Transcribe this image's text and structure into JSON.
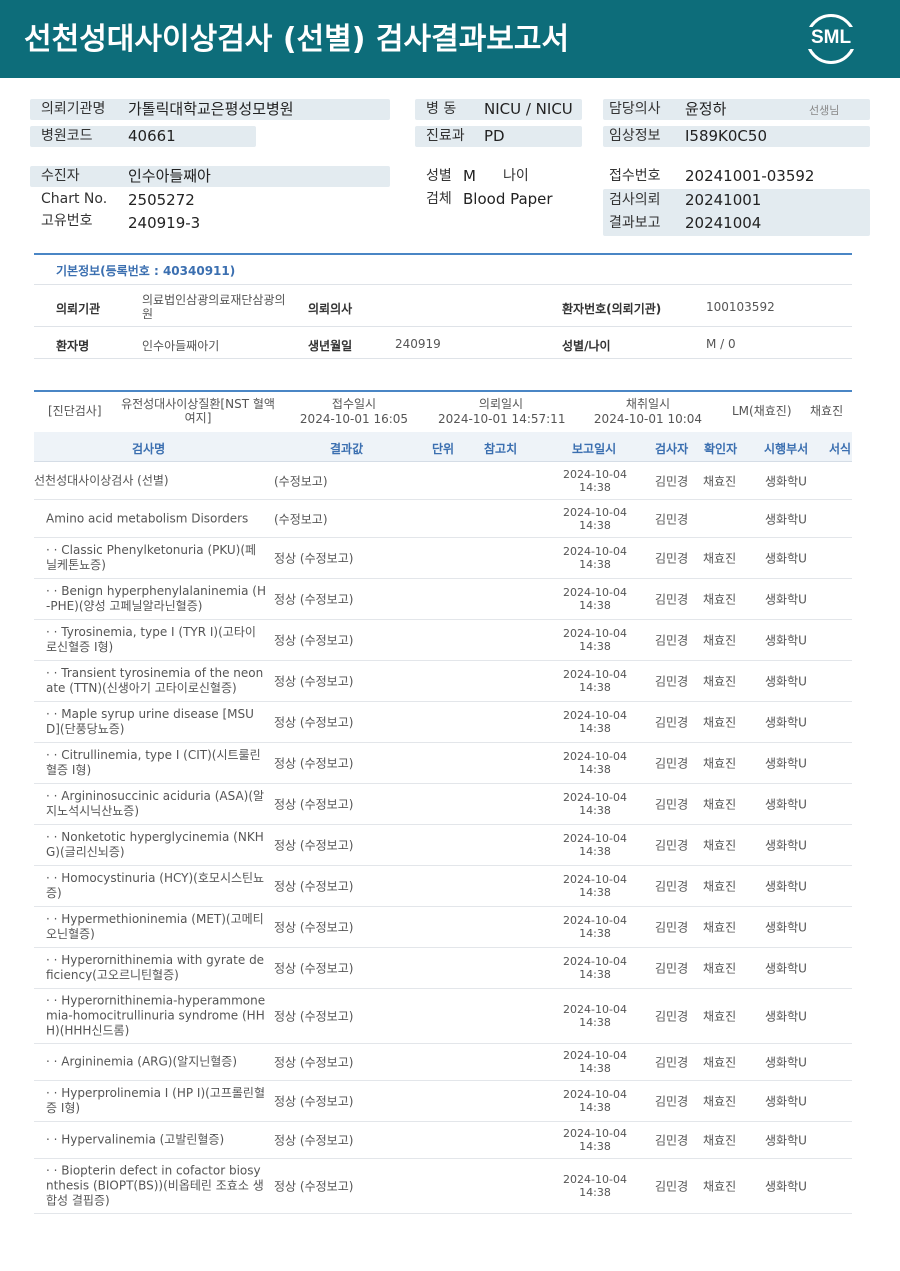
{
  "header": {
    "title": "선천성대사이상검사 (선별) 검사결과보고서",
    "logo_text": "SML",
    "bg_color": "#0d6d7a"
  },
  "patient": {
    "req_org_label": "의뢰기관명",
    "req_org": "가톨릭대학교은평성모병원",
    "hosp_code_label": "병원코드",
    "hosp_code": "40661",
    "ward_label": "병 동",
    "ward": "NICU / NICU",
    "dept_label": "진료과",
    "dept": "PD",
    "doctor_label": "담당의사",
    "doctor": "윤정하",
    "doctor_suffix": "선생님",
    "clinical_label": "임상정보",
    "clinical": "I589K0C50",
    "recipient_label": "수진자",
    "recipient": "인수아들째아",
    "chart_label": "Chart No.",
    "chart": "2505272",
    "unique_label": "고유번호",
    "unique": "240919-3",
    "sex_label": "성별",
    "sex": "M",
    "age_label": "나이",
    "specimen_label": "검체",
    "specimen": "Blood Paper",
    "receipt_label": "접수번호",
    "receipt": "20241001-03592",
    "test_req_label": "검사의뢰",
    "test_req": "20241001",
    "result_label": "결과보고",
    "result": "20241004"
  },
  "basic_info": {
    "title": "기본정보(등록번호 : 40340911)",
    "org_label": "의뢰기관",
    "org": "의료법인삼광의료재단삼광의원",
    "doc_label": "의뢰의사",
    "doc": "",
    "pid_label": "환자번호(의뢰기관)",
    "pid": "100103592",
    "name_label": "환자명",
    "name": "인수아들째아기",
    "birth_label": "생년월일",
    "birth": "240919",
    "sexage_label": "성별/나이",
    "sexage": "M / 0"
  },
  "test_meta": {
    "category": "[진단검사]",
    "test_name": "유전성대사이상질환[NST 혈액여지]",
    "receipt_label": "접수일시",
    "receipt_time": "2024-10-01 16:05",
    "request_label": "의뢰일시",
    "request_time": "2024-10-01 14:57:11",
    "collect_label": "채취일시",
    "collect_time": "2024-10-01 10:04",
    "lm": "LM(채효진)",
    "lm_name": "채효진"
  },
  "table": {
    "headers": {
      "name": "검사명",
      "result": "결과값",
      "unit": "단위",
      "ref": "참고치",
      "report": "보고일시",
      "checker": "검사자",
      "confirmer": "확인자",
      "dept": "시행부서",
      "format": "서식"
    },
    "rows": [
      {
        "name": "선천성대사이상검사 (선별)",
        "result": "(수정보고)",
        "date": "2024-10-04",
        "time": "14:38",
        "checker": "김민경",
        "confirmer": "채효진",
        "dept": "생화학U"
      },
      {
        "name": "Amino acid metabolism Disorders",
        "result": "(수정보고)",
        "date": "2024-10-04",
        "time": "14:38",
        "checker": "김민경",
        "confirmer": "",
        "dept": "생화학U"
      },
      {
        "name": "· · Classic Phenylketonuria (PKU)(페닐케톤뇨증)",
        "result": "정상 (수정보고)",
        "date": "2024-10-04",
        "time": "14:38",
        "checker": "김민경",
        "confirmer": "채효진",
        "dept": "생화학U"
      },
      {
        "name": "· · Benign hyperphenylalaninemia (H-PHE)(양성 고페닐알라닌혈증)",
        "result": "정상 (수정보고)",
        "date": "2024-10-04",
        "time": "14:38",
        "checker": "김민경",
        "confirmer": "채효진",
        "dept": "생화학U"
      },
      {
        "name": "· · Tyrosinemia, type I (TYR I)(고타이로신혈증 I형)",
        "result": "정상 (수정보고)",
        "date": "2024-10-04",
        "time": "14:38",
        "checker": "김민경",
        "confirmer": "채효진",
        "dept": "생화학U"
      },
      {
        "name": "· · Transient tyrosinemia of the neonate (TTN)(신생아기 고타이로신혈증)",
        "result": "정상 (수정보고)",
        "date": "2024-10-04",
        "time": "14:38",
        "checker": "김민경",
        "confirmer": "채효진",
        "dept": "생화학U"
      },
      {
        "name": "· · Maple syrup urine disease [MSUD](단풍당뇨증)",
        "result": "정상 (수정보고)",
        "date": "2024-10-04",
        "time": "14:38",
        "checker": "김민경",
        "confirmer": "채효진",
        "dept": "생화학U"
      },
      {
        "name": "· · Citrullinemia, type I (CIT)(시트룰린혈증 I형)",
        "result": "정상 (수정보고)",
        "date": "2024-10-04",
        "time": "14:38",
        "checker": "김민경",
        "confirmer": "채효진",
        "dept": "생화학U"
      },
      {
        "name": "· · Argininosuccinic aciduria (ASA)(알지노석시닉산뇨증)",
        "result": "정상 (수정보고)",
        "date": "2024-10-04",
        "time": "14:38",
        "checker": "김민경",
        "confirmer": "채효진",
        "dept": "생화학U"
      },
      {
        "name": "· · Nonketotic hyperglycinemia (NKHG)(글리신뇌증)",
        "result": "정상 (수정보고)",
        "date": "2024-10-04",
        "time": "14:38",
        "checker": "김민경",
        "confirmer": "채효진",
        "dept": "생화학U"
      },
      {
        "name": "· · Homocystinuria (HCY)(호모시스틴뇨증)",
        "result": "정상 (수정보고)",
        "date": "2024-10-04",
        "time": "14:38",
        "checker": "김민경",
        "confirmer": "채효진",
        "dept": "생화학U"
      },
      {
        "name": "· · Hypermethioninemia (MET)(고메티오닌혈증)",
        "result": "정상 (수정보고)",
        "date": "2024-10-04",
        "time": "14:38",
        "checker": "김민경",
        "confirmer": "채효진",
        "dept": "생화학U"
      },
      {
        "name": "· · Hyperornithinemia with gyrate deficiency(고오르니틴혈증)",
        "result": "정상 (수정보고)",
        "date": "2024-10-04",
        "time": "14:38",
        "checker": "김민경",
        "confirmer": "채효진",
        "dept": "생화학U"
      },
      {
        "name": "· · Hyperornithinemia-hyperammonemia-homocitrullinuria syndrome (HHH)(HHH신드롬)",
        "result": "정상 (수정보고)",
        "date": "2024-10-04",
        "time": "14:38",
        "checker": "김민경",
        "confirmer": "채효진",
        "dept": "생화학U"
      },
      {
        "name": "· · Argininemia (ARG)(알지닌혈증)",
        "result": "정상 (수정보고)",
        "date": "2024-10-04",
        "time": "14:38",
        "checker": "김민경",
        "confirmer": "채효진",
        "dept": "생화학U"
      },
      {
        "name": "· · Hyperprolinemia I (HP I)(고프롤린혈증 I형)",
        "result": "정상 (수정보고)",
        "date": "2024-10-04",
        "time": "14:38",
        "checker": "김민경",
        "confirmer": "채효진",
        "dept": "생화학U"
      },
      {
        "name": "· · Hypervalinemia (고발린혈증)",
        "result": "정상 (수정보고)",
        "date": "2024-10-04",
        "time": "14:38",
        "checker": "김민경",
        "confirmer": "채효진",
        "dept": "생화학U"
      },
      {
        "name": "· · Biopterin defect in cofactor biosynthesis (BIOPT(BS))(비옵테린 조효소 생합성 결핍증)",
        "result": "정상 (수정보고)",
        "date": "2024-10-04",
        "time": "14:38",
        "checker": "김민경",
        "confirmer": "채효진",
        "dept": "생화학U"
      }
    ]
  }
}
